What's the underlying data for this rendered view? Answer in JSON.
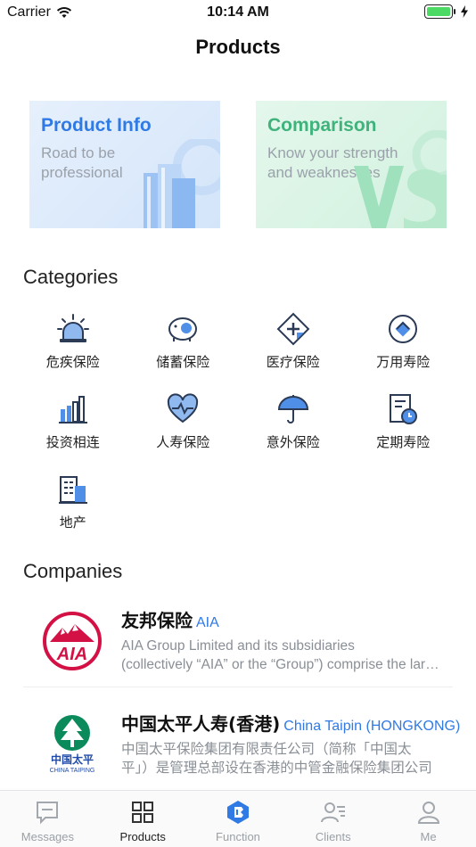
{
  "status": {
    "carrier": "Carrier",
    "time": "10:14 AM"
  },
  "nav": {
    "title": "Products"
  },
  "cards": {
    "info": {
      "title": "Product Info",
      "subtitle_line1": "Road to be",
      "subtitle_line2": "professional"
    },
    "comparison": {
      "title": "Comparison",
      "subtitle_line1": "Know your strength",
      "subtitle_line2": "and weaknesses"
    }
  },
  "categories": {
    "title": "Categories",
    "items": [
      {
        "label": "危疾保险",
        "icon": "siren-icon"
      },
      {
        "label": "储蓄保险",
        "icon": "piggy-bank-icon"
      },
      {
        "label": "医疗保险",
        "icon": "medical-cross-icon"
      },
      {
        "label": "万用寿险",
        "icon": "shield-badge-icon"
      },
      {
        "label": "投资相连",
        "icon": "bar-chart-icon"
      },
      {
        "label": "人寿保险",
        "icon": "heart-pulse-icon"
      },
      {
        "label": "意外保险",
        "icon": "umbrella-icon"
      },
      {
        "label": "定期寿险",
        "icon": "document-clock-icon"
      },
      {
        "label": "地产",
        "icon": "building-icon"
      }
    ]
  },
  "companies": {
    "title": "Companies",
    "items": [
      {
        "name": "友邦保险",
        "en": "AIA",
        "logo_text": "AIA",
        "desc_line1": "AIA Group Limited and its subsidiaries",
        "desc_line2": "(collectively “AIA” or the “Group”) comprise the largest"
      },
      {
        "name": "中国太平人寿(香港)",
        "en": "China Taipin (HONGKONG)",
        "logo_text_cn": "中国太平",
        "logo_text_en": "CHINA TAIPING",
        "desc_line1": "中国太平保险集团有限责任公司（简称「中国太",
        "desc_line2": "平」）是管理总部设在香港的中管金融保险集团公司"
      }
    ]
  },
  "tabs": [
    {
      "label": "Messages",
      "icon": "message-icon"
    },
    {
      "label": "Products",
      "icon": "grid-icon"
    },
    {
      "label": "Function",
      "icon": "function-logo-icon"
    },
    {
      "label": "Clients",
      "icon": "clients-icon"
    },
    {
      "label": "Me",
      "icon": "person-icon"
    }
  ],
  "colors": {
    "accent": "#2f7ae5",
    "green": "#3fb37b",
    "aia_red": "#d31145",
    "taiping_green": "#0b8a5c"
  }
}
